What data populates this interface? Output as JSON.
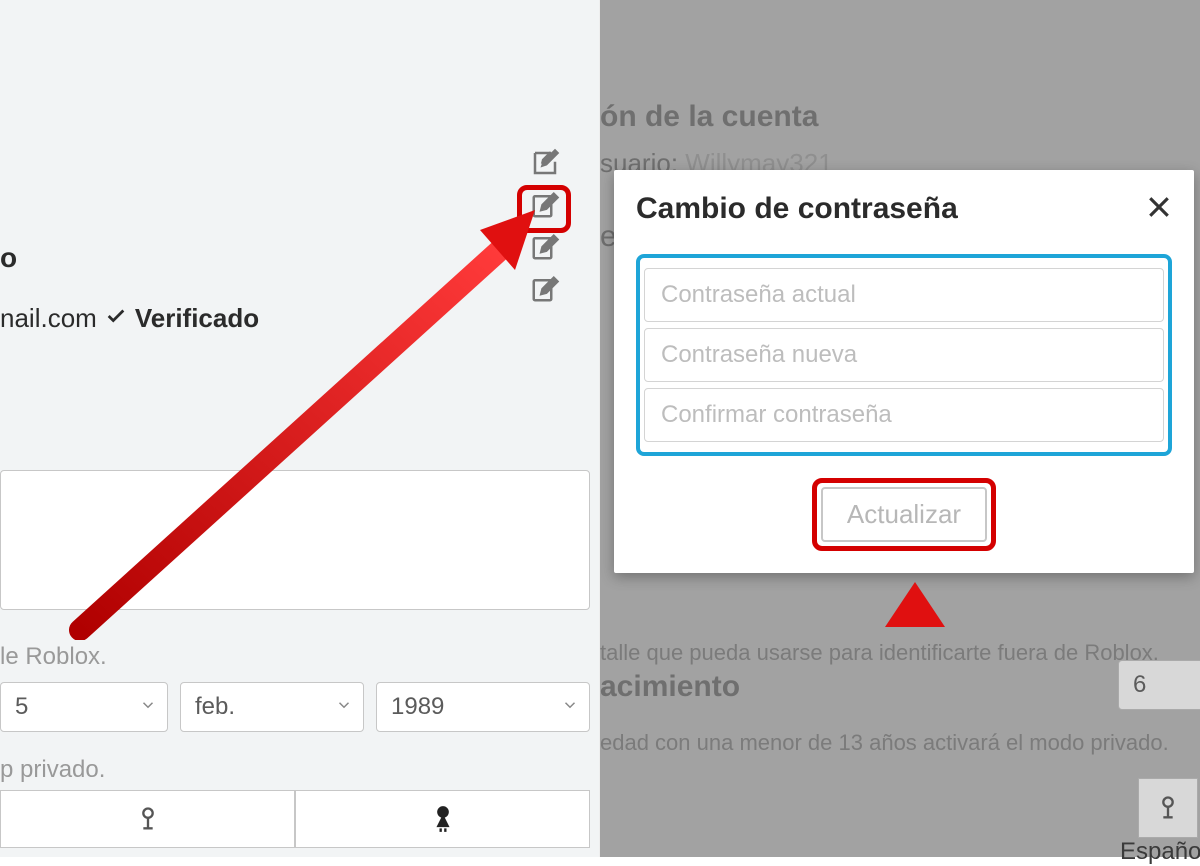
{
  "left": {
    "label_o": "o",
    "email_partial": "nail.com",
    "verified": "Verificado",
    "roblox_text": "le Roblox.",
    "dob": {
      "day": "5",
      "month": "feb.",
      "year": "1989"
    },
    "privado_text": "p privado."
  },
  "right": {
    "account_title_partial": "ón de la cuenta",
    "user_label": "suario:",
    "username": "Willymay321",
    "e_partial": "e",
    "detail_text": "talle que pueda usarse para identificarte fuera de Roblox.",
    "nacimiento": "acimiento",
    "edad_text": "edad con una menor de 13 años activará el modo privado.",
    "day": "6",
    "language": "Español"
  },
  "modal": {
    "title": "Cambio de contraseña",
    "current_pwd": "Contraseña actual",
    "new_pwd": "Contraseña nueva",
    "confirm_pwd": "Confirmar contraseña",
    "update_btn": "Actualizar"
  }
}
